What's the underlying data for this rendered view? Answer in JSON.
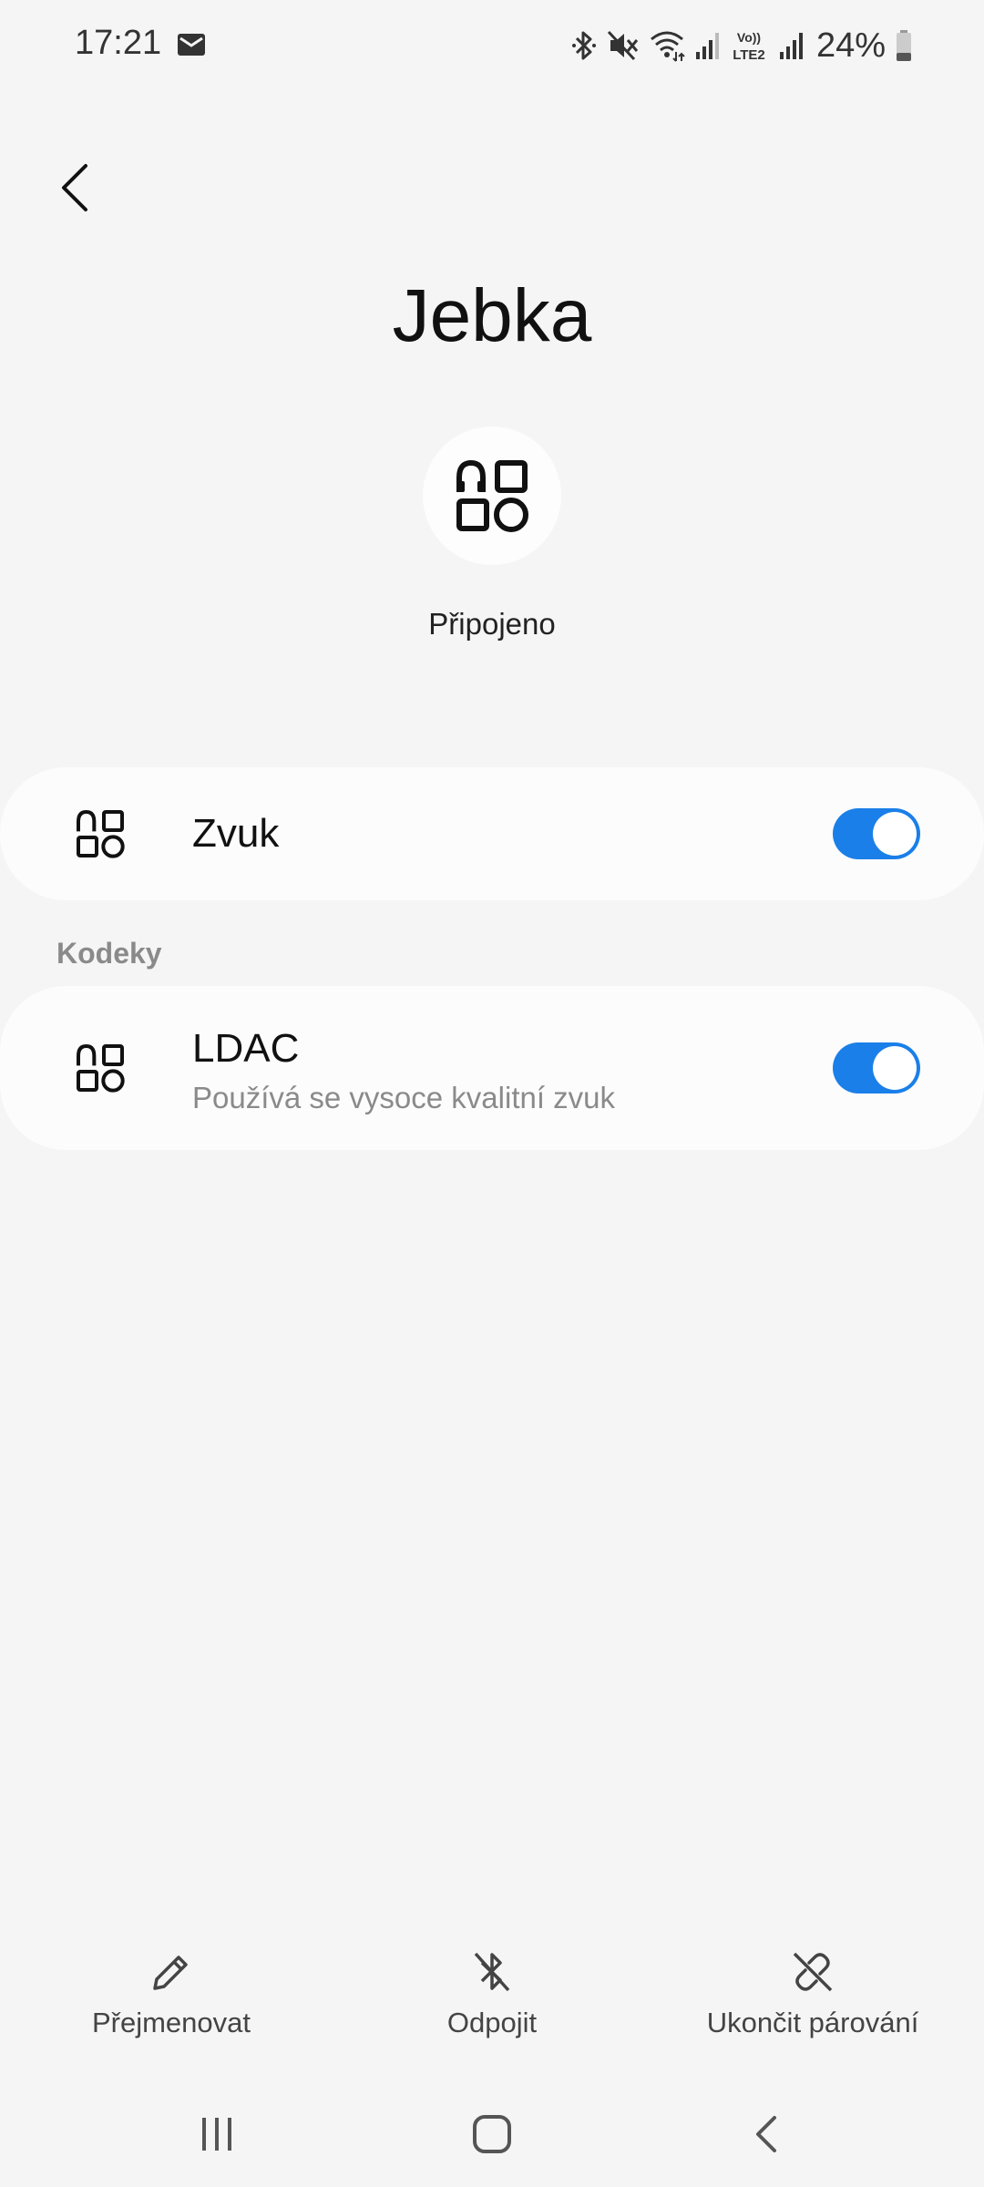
{
  "status_bar": {
    "time": "17:21",
    "battery": "24%",
    "icons": [
      "mail-icon",
      "bluetooth-icon",
      "mute-icon",
      "wifi-icon",
      "signal-icon",
      "volte-lte2-icon",
      "signal-icon",
      "battery-icon"
    ],
    "volte_label_top": "Vo))",
    "volte_label_bottom": "LTE2"
  },
  "header": {
    "back_icon": "back-arrow-icon",
    "device_name": "Jebka",
    "device_icon": "device-shapes-icon",
    "status": "Připojeno"
  },
  "settings": {
    "sound": {
      "title": "Zvuk",
      "enabled": true,
      "icon": "device-shapes-icon"
    },
    "codecs_section": "Kodeky",
    "ldac": {
      "title": "LDAC",
      "subtitle": "Používá se vysoce kvalitní zvuk",
      "enabled": true,
      "icon": "device-shapes-icon"
    }
  },
  "actions": [
    {
      "label": "Přejmenovat",
      "icon": "pencil-icon"
    },
    {
      "label": "Odpojit",
      "icon": "bluetooth-off-icon"
    },
    {
      "label": "Ukončit párování",
      "icon": "unlink-icon"
    }
  ],
  "colors": {
    "accent": "#1a7fe8",
    "background": "#f5f5f5",
    "card": "#fcfcfc",
    "secondary_text": "#8a8a8a"
  },
  "nav_bar": [
    "recents-icon",
    "home-icon",
    "back-icon"
  ]
}
